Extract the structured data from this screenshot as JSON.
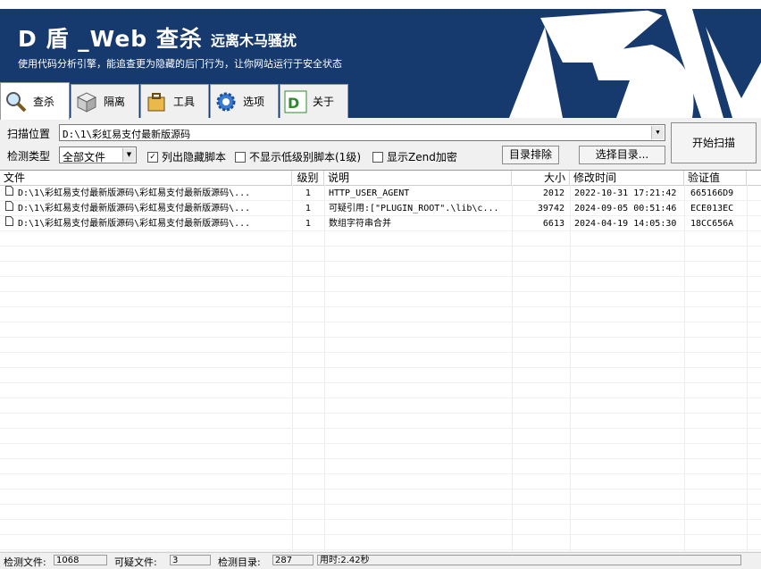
{
  "banner": {
    "title": "D 盾 _Web 查杀",
    "subtitle": "远离木马骚扰",
    "slogan": "使用代码分析引擎，能追查更为隐藏的后门行为，让你网站运行于安全状态"
  },
  "tabs": [
    {
      "label": "查杀",
      "icon": "magnifier-icon",
      "active": true
    },
    {
      "label": "隔离",
      "icon": "box-icon",
      "active": false
    },
    {
      "label": "工具",
      "icon": "briefcase-icon",
      "active": false
    },
    {
      "label": "选项",
      "icon": "gear-icon",
      "active": false
    },
    {
      "label": "关于",
      "icon": "d-shield-logo-icon",
      "active": false
    }
  ],
  "toolbar": {
    "scan_location_label": "扫描位置",
    "scan_location_value": "D:\\1\\彩虹易支付最新版源码",
    "detect_type_label": "检测类型",
    "detect_type_value": "全部文件",
    "opt_show_hidden": {
      "label": "列出隐藏脚本",
      "checked": true
    },
    "opt_hide_low": {
      "label": "不显示低级别脚本(1级)",
      "checked": false
    },
    "opt_show_zend": {
      "label": "显示Zend加密",
      "checked": false
    },
    "exclude_dir_button": "目录排除",
    "select_dir_button": "选择目录...",
    "start_scan_button": "开始扫描"
  },
  "table": {
    "columns": [
      "文件",
      "级别",
      "说明",
      "大小",
      "修改时间",
      "验证值"
    ],
    "rows": [
      {
        "file": "D:\\1\\彩虹易支付最新版源码\\彩虹易支付最新版源码\\...",
        "level": "1",
        "desc": "HTTP_USER_AGENT",
        "size": "2012",
        "mtime": "2022-10-31 17:21:42",
        "hash": "665166D9"
      },
      {
        "file": "D:\\1\\彩虹易支付最新版源码\\彩虹易支付最新版源码\\...",
        "level": "1",
        "desc": "可疑引用:[\"PLUGIN_ROOT\".\\lib\\c...",
        "size": "39742",
        "mtime": "2024-09-05 00:51:46",
        "hash": "ECE013EC"
      },
      {
        "file": "D:\\1\\彩虹易支付最新版源码\\彩虹易支付最新版源码\\...",
        "level": "1",
        "desc": "数组字符串合并",
        "size": "6613",
        "mtime": "2024-04-19 14:05:30",
        "hash": "18CC656A"
      }
    ]
  },
  "status": {
    "files_label": "检测文件:",
    "files_value": "1068",
    "suspicious_label": "可疑文件:",
    "suspicious_value": "3",
    "dirs_label": "检测目录:",
    "dirs_value": "287",
    "time_text": "用时:2.42秒"
  },
  "colors": {
    "banner_bg": "#163a6e",
    "banner_text": "#ffffff"
  }
}
